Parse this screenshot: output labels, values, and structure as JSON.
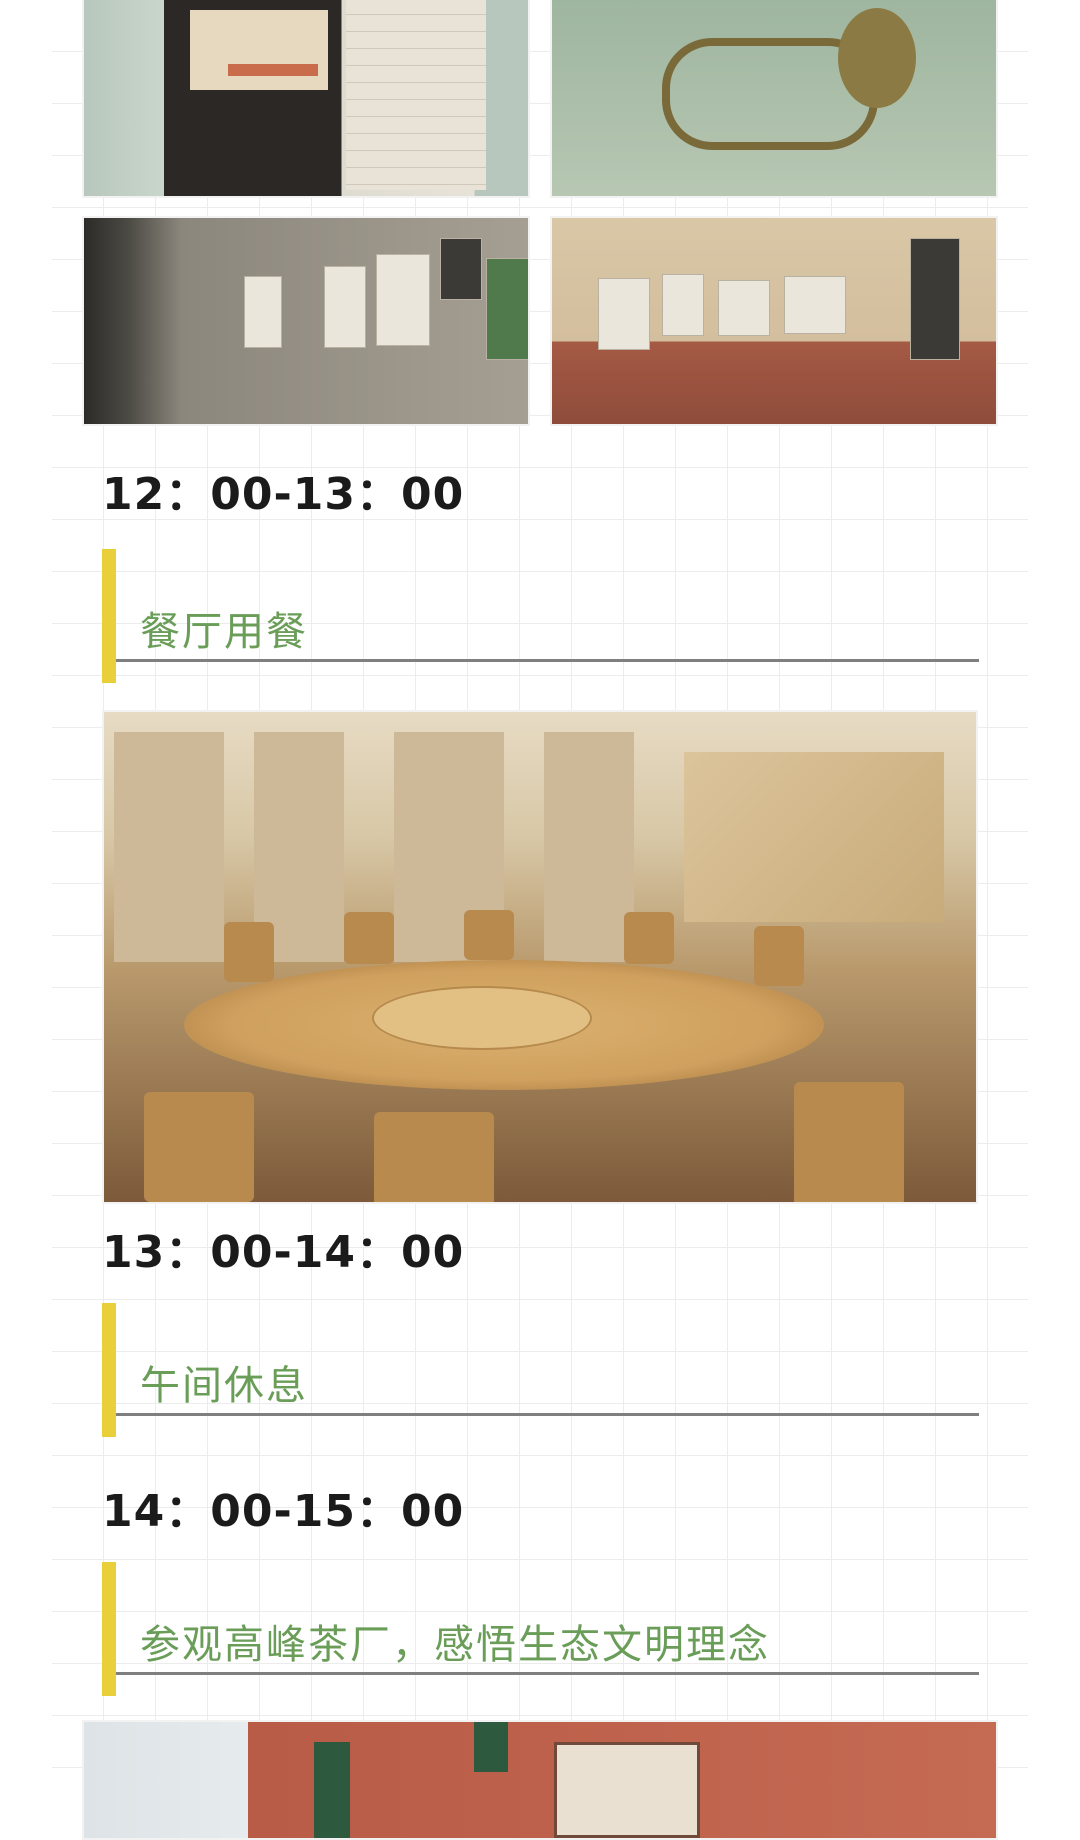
{
  "schedule": [
    {
      "time": "12：00-13：00",
      "activity": "餐厅用餐"
    },
    {
      "time": "13：00-14：00",
      "activity": "午间休息"
    },
    {
      "time": "14：00-15：00",
      "activity": "参观高峰茶厂，感悟生态文明理念"
    }
  ],
  "colors": {
    "accent_bar": "#e9cf3a",
    "title_green": "#6a9d58",
    "rule_gray": "#7f7f7f",
    "grid": "#ececec"
  }
}
